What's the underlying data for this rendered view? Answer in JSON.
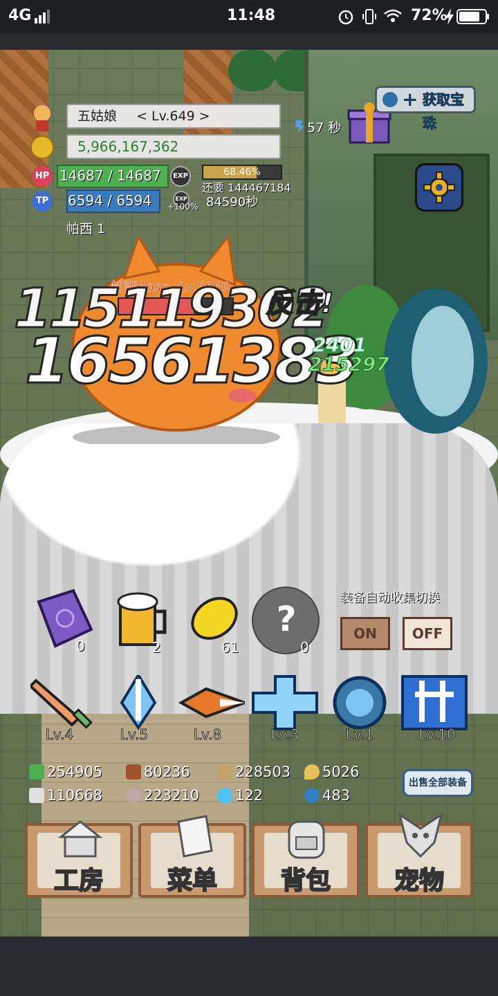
{
  "status_bar": {
    "network": "4G",
    "time": "11:48",
    "battery": "72%"
  },
  "player": {
    "name": "五姑娘",
    "level": "< Lv.649 >",
    "gold": "5,966,167,362",
    "hp": "14687 / 14687",
    "tp": "6594 / 6594",
    "exp_percent": "68.46%",
    "exp_remaining": "还要 144467184",
    "exp_bonus": "+100%",
    "exp_timer": "84590秒",
    "pet_name": "帕西 1",
    "speed_timer": "57 秒",
    "exp_fill": 0.6846
  },
  "top_buttons": {
    "acquire_label": "获取宝珠"
  },
  "battle": {
    "boss_label": "帕西Boss",
    "boss_level": "Lv.5000",
    "boss_hp_fill": 0.66,
    "damage_back": "115119302",
    "damage_front": "16561383",
    "counter_text": "反击!",
    "ally_damage_1": "2401",
    "ally_damage_2": "215297"
  },
  "items": [
    {
      "name": "book",
      "count": "0"
    },
    {
      "name": "beer",
      "count": "2"
    },
    {
      "name": "lemon",
      "count": "61"
    },
    {
      "name": "unknown",
      "count": "0"
    }
  ],
  "auto_collect": {
    "title": "装备自动收集切换",
    "on_label": "ON",
    "off_label": "OFF"
  },
  "skills": [
    {
      "name": "sword",
      "level": "Lv.4"
    },
    {
      "name": "ice-sword",
      "level": "Lv.5"
    },
    {
      "name": "fire-spear",
      "level": "Lv.8"
    },
    {
      "name": "holy-cross",
      "level": "Lv.3"
    },
    {
      "name": "orb",
      "level": "Lv.1"
    },
    {
      "name": "thunder",
      "level": "Lv.10"
    }
  ],
  "resources": [
    {
      "name": "herb",
      "value": "254905",
      "color": "#4caf50"
    },
    {
      "name": "wood",
      "value": "80236",
      "color": "#a0522d"
    },
    {
      "name": "plank",
      "value": "228503",
      "color": "#c2a46a"
    },
    {
      "name": "drop",
      "value": "5026",
      "color": "#e6c15a"
    },
    {
      "name": "iron",
      "value": "110668",
      "color": "#e0e0e0"
    },
    {
      "name": "stone",
      "value": "223210",
      "color": "#bfa9a0"
    },
    {
      "name": "flame",
      "value": "122",
      "color": "#4fc3f7"
    },
    {
      "name": "gem",
      "value": "483",
      "color": "#2f7fc1"
    }
  ],
  "sell_all_label": "出售全部装备",
  "menu": [
    {
      "name": "workshop",
      "label": "工房"
    },
    {
      "name": "menu",
      "label": "菜单"
    },
    {
      "name": "bag",
      "label": "背包"
    },
    {
      "name": "pet",
      "label": "宠物"
    }
  ]
}
